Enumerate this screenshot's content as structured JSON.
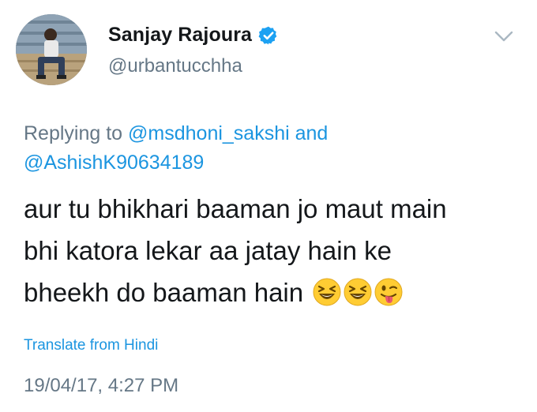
{
  "author": {
    "name": "Sanjay Rajoura",
    "handle": "@urbantucchha",
    "verified": true
  },
  "reply": {
    "prefix": "Replying to",
    "mention1": "@msdhoni_sakshi",
    "conjunction": "and",
    "mention2": "@AshishK90634189"
  },
  "tweet": {
    "line1": "aur tu bhikhari baaman jo maut main",
    "line2": "bhi katora lekar aa jatay hain ke",
    "line3": "bheekh do baaman hain",
    "emojis": [
      "laughing-face-emoji",
      "laughing-face-emoji",
      "winking-tongue-emoji"
    ]
  },
  "translate_label": "Translate from Hindi",
  "timestamp": "19/04/17, 4:27 PM",
  "colors": {
    "link": "#1b95e0",
    "text": "#14171a",
    "muted": "#657786",
    "verified": "#1da1f2"
  }
}
